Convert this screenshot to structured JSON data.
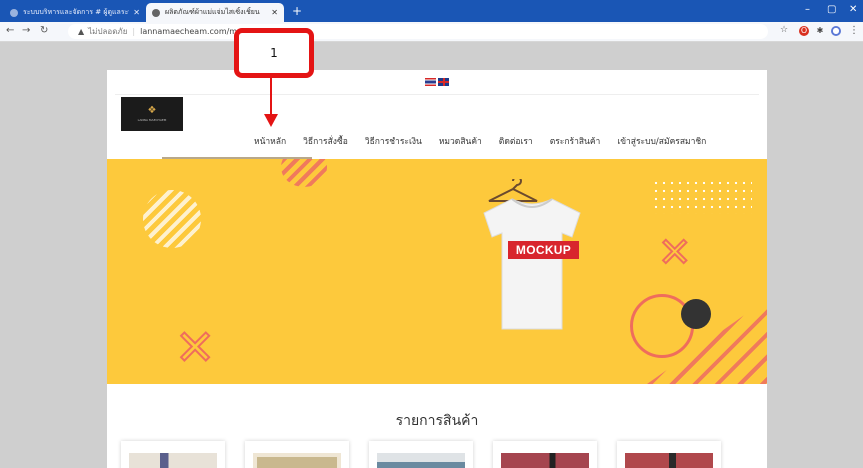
{
  "browser": {
    "tabs": [
      {
        "title": "ระบบบริหารและจัดการ # ผู้ดูแลระบบ",
        "active": false
      },
      {
        "title": "ผลิตภัณฑ์ผ้าแม่แจ่มไสเซิ้งเชิ้ยน",
        "active": true
      }
    ],
    "new_tab_icon": "+",
    "address": {
      "security_label": "ไม่ปลอดภัย",
      "url": "lannamaecheam.com/main"
    },
    "controls": {
      "minimize": "–",
      "maximize": "▢",
      "close": "✕"
    }
  },
  "site": {
    "logo_text": "LANNA MAECHAEM",
    "menu": [
      {
        "label": "หน้าหลัก"
      },
      {
        "label": "วิธีการสั่งซื้อ"
      },
      {
        "label": "วิธีการชำระเงิน"
      },
      {
        "label": "หมวดสินค้า"
      },
      {
        "label": "ติดต่อเรา"
      },
      {
        "label": "ตระกร้าสินค้า"
      },
      {
        "label": "เข้าสู่ระบบ/สมัครสมาชิก"
      }
    ],
    "banner": {
      "shirt_label": "MOCKUP"
    },
    "products": {
      "title": "รายการสินค้า",
      "cards": [
        {
          "thumb_color": "#5a5f8c"
        },
        {
          "thumb_color": "#c9b88e"
        },
        {
          "thumb_color": "#6a8aa0"
        },
        {
          "thumb_color": "#a5454f"
        },
        {
          "thumb_color": "#b0484c"
        }
      ]
    }
  },
  "annotation": {
    "number": "1"
  },
  "colors": {
    "tabbar": "#1a56b5",
    "banner": "#fdc93c",
    "accent": "#ef6d5c",
    "annotation": "#e41414"
  }
}
